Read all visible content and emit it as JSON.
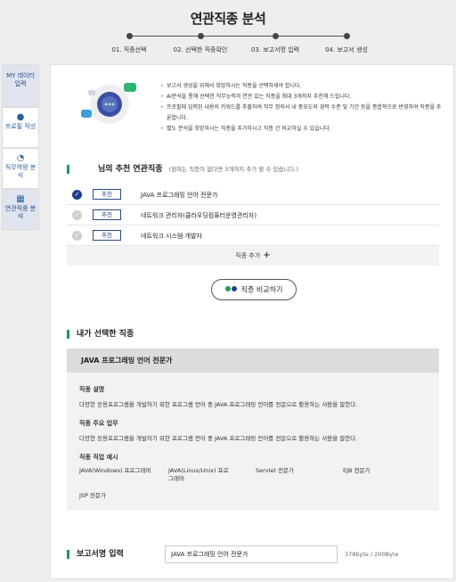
{
  "page_title": "연관직종 분석",
  "steps": [
    "01. 직종선택",
    "02. 선택한 직종확인",
    "03. 보고서명 입력",
    "04. 보고서 생성"
  ],
  "sidebar": [
    {
      "label": "MY 데이터 입력",
      "icon": "database-icon"
    },
    {
      "label": "프로필 작성",
      "icon": "person-icon"
    },
    {
      "label": "직무역량 분석",
      "icon": "pie-chart-icon"
    },
    {
      "label": "연관직종 분석",
      "icon": "grid-icon"
    }
  ],
  "intro_bullets": [
    "보고서 생성을 위해서 희망하시는 직종을 선택하세야 합니다.",
    "AI분석을 통해 선택한 직무능력과 연관 있는 직종을 최대 3개까지 추천해 드립니다.",
    "프로필에 입력된 내용의 키워드를 추출하여 직무 정의서 내 중요도와 경력 수준 및 기간 등을 종합적으로 반영하여 직종을 추론합니다.",
    "별도 분석을 희망하시는 직종을 추가하시고 직종 간 비교하실 수 있습니다."
  ],
  "recommend": {
    "title": "님의 추천 연관직종",
    "subtitle": "(원하는 직종이 없다면 3개까지 추가 할 수 있습니다.)",
    "tag_label": "추천",
    "items": [
      {
        "name": "JAVA 프로그래밍 언어 전문가",
        "checked": true
      },
      {
        "name": "네트워크 관리자(클라우딩컴퓨터운영관리자)",
        "checked": false
      },
      {
        "name": "네트워크 시스템 개발자",
        "checked": false
      }
    ],
    "add_label": "직종 추가"
  },
  "compare_button": "직종 비교하기",
  "selected": {
    "section_title": "내가 선택한 직종",
    "job_name": "JAVA 프로그래밍 언어 전문가",
    "desc_label": "직종 설명",
    "desc_text": "다양한 응용프로그램을 개발하기 위한 프로그램 언어 중 JAVA 프로그래밍 언어를 전문으로 활용하는 사람을 말한다.",
    "duty_label": "직종 주요 업무",
    "duty_text": "다양한 응용프로그램을 개발하기 위한 프로그램 언어 중 JAVA 프로그래밍 언어를 전문으로 활용하는 사람을 말한다.",
    "example_label": "직종 직업 예시",
    "examples": [
      "JAVA(Windows) 프로그래머",
      "JAVA(Linux/Unix) 프로그래머",
      "Servlet 전문가",
      "EJB 전문가",
      "JSP 전문가"
    ]
  },
  "report": {
    "title": "보고서명 입력",
    "value": "JAVA 프로그래밍 언어 전문가",
    "counter": "378byte / 200Byte"
  },
  "colors": {
    "accent_green": "#1b9b5a",
    "accent_navy": "#1d3f8f",
    "bullet_orange": "#e06b2c"
  }
}
